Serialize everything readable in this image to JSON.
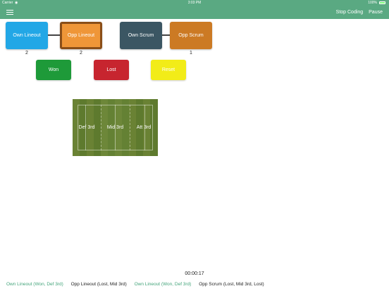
{
  "status": {
    "carrier": "Carrier",
    "time": "3:03 PM",
    "battery": "100%"
  },
  "nav": {
    "stop_label": "Stop Coding",
    "pause_label": "Pause"
  },
  "events": [
    {
      "label": "Own Lineout",
      "count": "2",
      "color": "#22a7e6"
    },
    {
      "label": "Opp Lineout",
      "count": "2",
      "color": "#ef9638",
      "border": "#8a4e18"
    },
    {
      "label": "Own Scrum",
      "count": "",
      "color": "#3b5663"
    },
    {
      "label": "Opp Scrum",
      "count": "1",
      "color": "#cc7a24"
    }
  ],
  "outcomes": [
    {
      "label": "Won",
      "color": "#1e9a39"
    },
    {
      "label": "Lost",
      "color": "#c7252f"
    },
    {
      "label": "Reset",
      "color": "#f2ec18"
    }
  ],
  "field": {
    "zones": [
      "Def 3rd",
      "Mid 3rd",
      "Att 3rd"
    ]
  },
  "timer": "00:00:17",
  "log": [
    {
      "text": "Own Lineout (Won, Def 3rd)",
      "color": "#43a47a"
    },
    {
      "text": "Opp Lineout (Lost, Mid 3rd)",
      "color": "#222222"
    },
    {
      "text": "Own Lineout (Won, Def 3rd)",
      "color": "#43a47a"
    },
    {
      "text": "Opp Scrum (Lost, Mid 3rd, Lost)",
      "color": "#222222"
    }
  ]
}
